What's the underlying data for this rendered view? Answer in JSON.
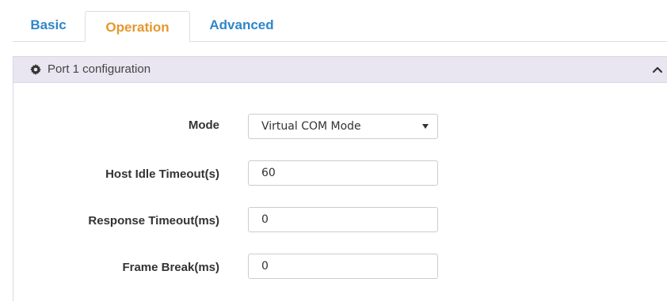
{
  "tabs": [
    {
      "label": "Basic"
    },
    {
      "label": "Operation",
      "active": true
    },
    {
      "label": "Advanced"
    }
  ],
  "colors": {
    "tab_link": "#2f86c9",
    "tab_active": "#e7972c",
    "panel_header_bg": "#eae6f1"
  },
  "panel": {
    "title": "Port 1 configuration",
    "icon": "gear-icon",
    "collapse_icon": "chevron-up-icon"
  },
  "form": {
    "mode": {
      "label": "Mode",
      "value": "Virtual COM Mode"
    },
    "host_idle_timeout": {
      "label": "Host Idle Timeout(s)",
      "value": "60"
    },
    "response_timeout": {
      "label": "Response Timeout(ms)",
      "value": "0"
    },
    "frame_break": {
      "label": "Frame Break(ms)",
      "value": "0"
    }
  }
}
